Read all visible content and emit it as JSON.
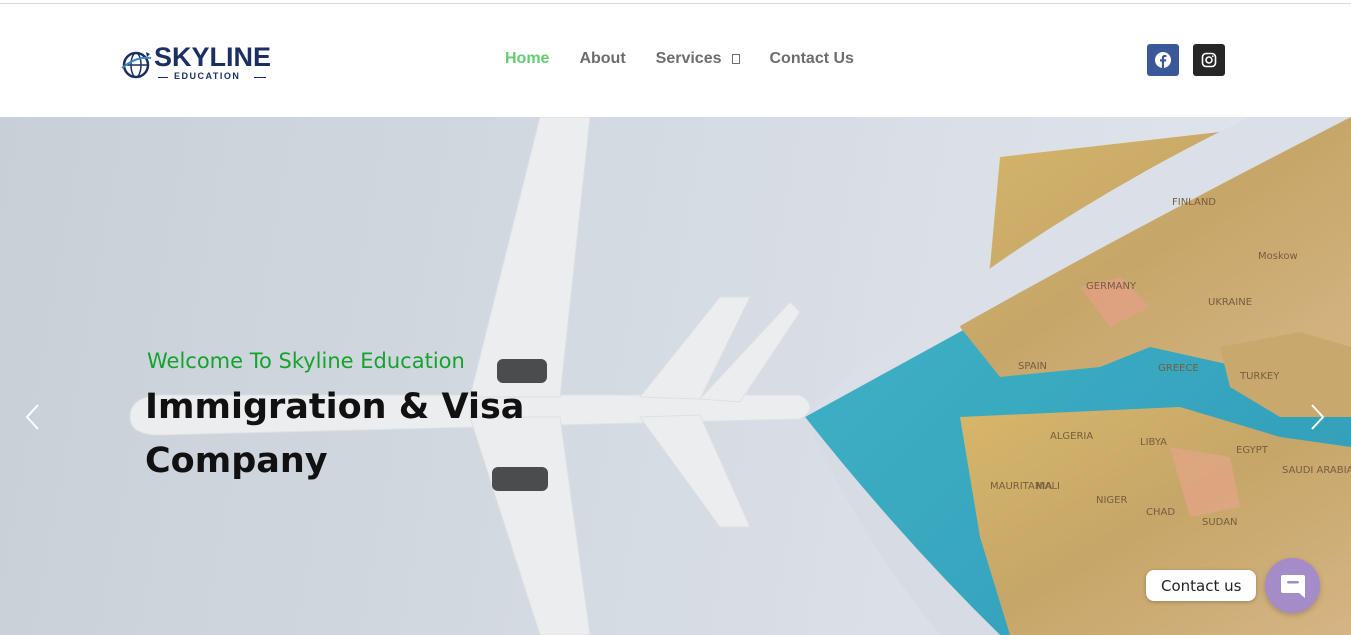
{
  "brand": {
    "name": "SKYLINE",
    "tagline": "EDUCATION",
    "primary_color": "#1b2f63",
    "accent_color": "#61ce70"
  },
  "nav": {
    "items": [
      {
        "label": "Home",
        "active": true
      },
      {
        "label": "About",
        "active": false
      },
      {
        "label": "Services",
        "active": false,
        "has_dropdown": true
      },
      {
        "label": "Contact Us",
        "active": false
      }
    ]
  },
  "social": [
    {
      "name": "facebook-icon",
      "color": "#3b5998"
    },
    {
      "name": "instagram-icon",
      "color": "#262626"
    }
  ],
  "hero": {
    "eyebrow": "Welcome To Skyline Education",
    "title": "Immigration & Visa Company",
    "eyebrow_color": "#14a32e",
    "map_labels": [
      "FINLAND",
      "Moskow",
      "GERMANY",
      "UKRAINE",
      "SPAIN",
      "GREECE",
      "TURKEY",
      "ALGERIA",
      "LIBYA",
      "EGYPT",
      "SAUDI ARABIA",
      "MAURITANIA",
      "MALI",
      "NIGER",
      "CHAD",
      "SUDAN"
    ]
  },
  "contact_widget": {
    "label": "Contact us",
    "color": "#a68bc9"
  }
}
